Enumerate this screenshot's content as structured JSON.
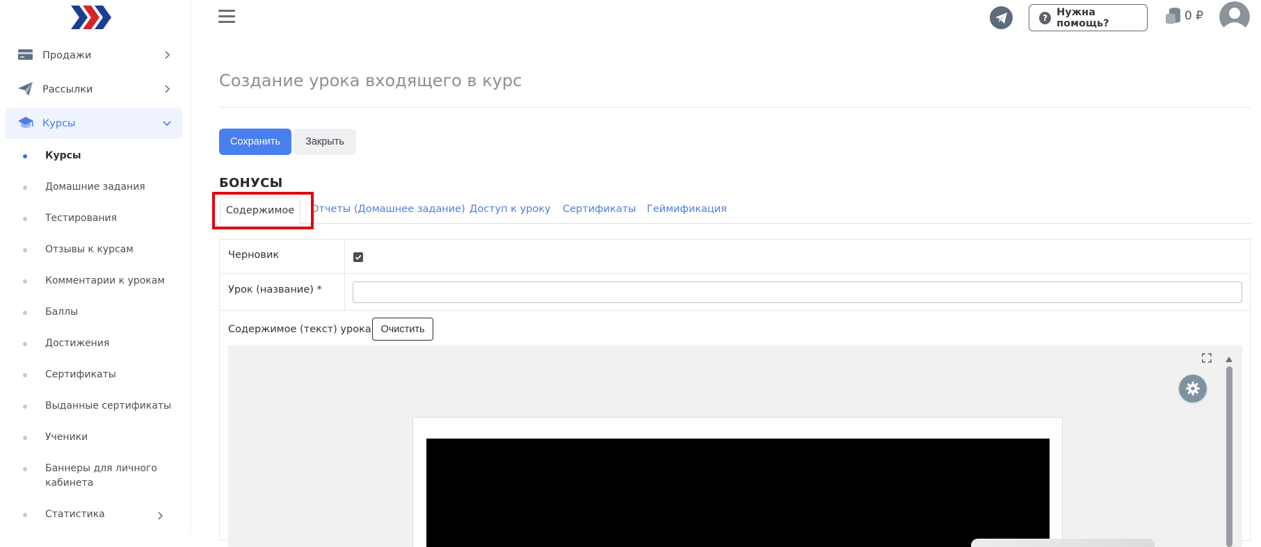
{
  "sidebar": {
    "menu": [
      {
        "label": "Продажи",
        "icon": "card-icon",
        "expanded": false
      },
      {
        "label": "Рассылки",
        "icon": "paper-plane-icon",
        "expanded": false
      },
      {
        "label": "Курсы",
        "icon": "graduation-cap-icon",
        "expanded": true,
        "active": true
      }
    ],
    "submenu": [
      {
        "label": "Курсы",
        "current": true
      },
      {
        "label": "Домашние задания"
      },
      {
        "label": "Тестирования"
      },
      {
        "label": "Отзывы к курсам"
      },
      {
        "label": "Комментарии к урокам"
      },
      {
        "label": "Баллы"
      },
      {
        "label": "Достижения"
      },
      {
        "label": "Сертификаты"
      },
      {
        "label": "Выданные сертификаты"
      },
      {
        "label": "Ученики"
      },
      {
        "label": "Баннеры для личного кабинета"
      },
      {
        "label": "Статистика",
        "has_children": true
      }
    ]
  },
  "header": {
    "help_label": "Нужна помощь?",
    "help_icon_text": "?",
    "balance": "0 ₽"
  },
  "main": {
    "title": "Создание урока входящего в курс",
    "save_label": "Сохранить",
    "close_label": "Закрыть",
    "section_title": "БОНУСЫ",
    "tabs": [
      {
        "label": "Содержимое",
        "active": true
      },
      {
        "label": "Отчеты (Домашнее задание)"
      },
      {
        "label": "Доступ к уроку"
      },
      {
        "label": "Сертификаты"
      },
      {
        "label": "Геймификация"
      }
    ],
    "form": {
      "draft_label": "Черновик",
      "draft_checked": true,
      "lesson_name_label": "Урок (название) *",
      "lesson_name_value": "",
      "content_label": "Содержимое (текст) урока *",
      "clear_label": "Очистить"
    }
  },
  "colors": {
    "accent": "#4a7ff0",
    "active_menu_bg": "#eef3fd",
    "highlight": "#e3000f",
    "logo_blue": "#1e3d8f",
    "logo_red": "#d8232a"
  }
}
